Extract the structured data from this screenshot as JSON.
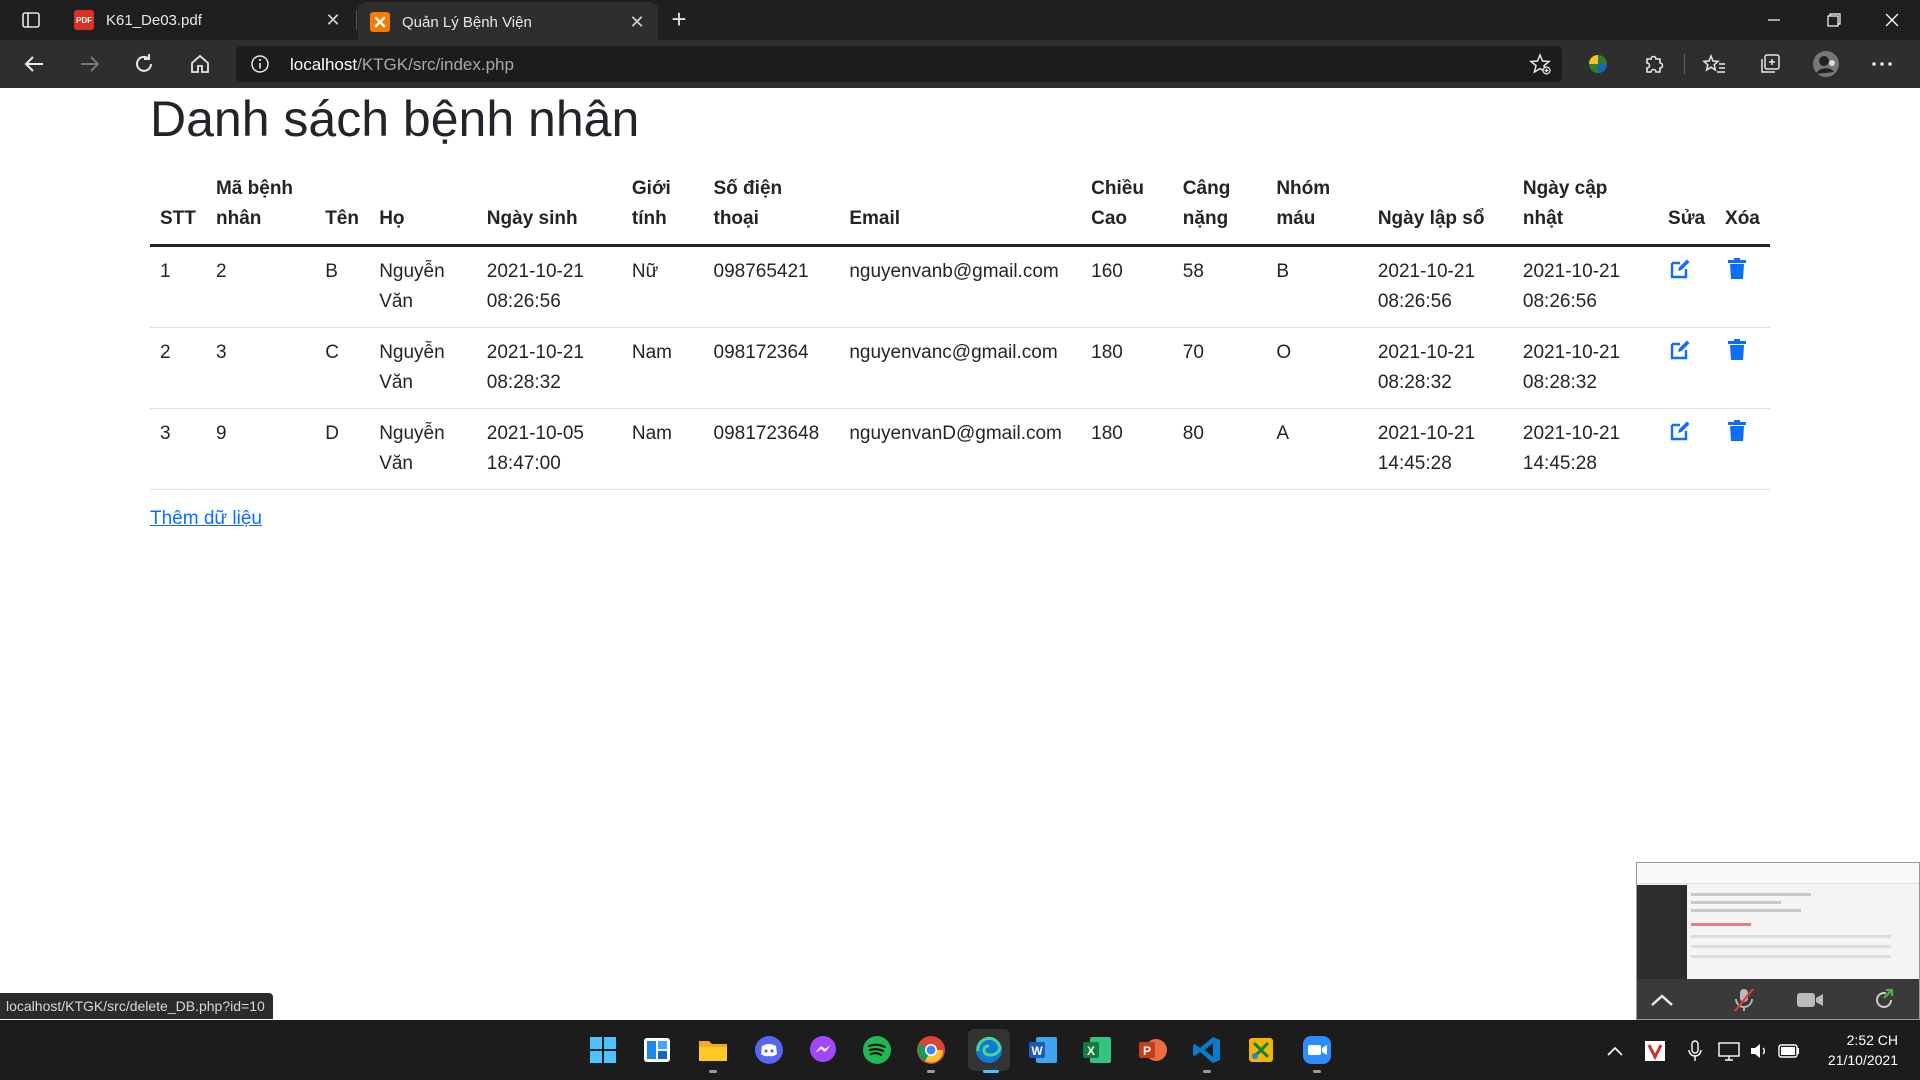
{
  "browser": {
    "tabs": [
      {
        "title": "K61_De03.pdf",
        "favicon": "pdf-icon",
        "active": false
      },
      {
        "title": "Quản Lý Bệnh Viện",
        "favicon": "xampp-icon",
        "active": true
      }
    ],
    "url_host": "localhost",
    "url_path": "/KTGK/src/index.php",
    "status_url": "localhost/KTGK/src/delete_DB.php?id=10"
  },
  "page": {
    "title": "Danh sách bệnh nhân",
    "add_link": "Thêm dữ liệu",
    "columns": [
      "STT",
      "Mã bệnh nhân",
      "Tên",
      "Họ",
      "Ngày sinh",
      "Giới tính",
      "Số điện thoại",
      "Email",
      "Chiều Cao",
      "Câng nặng",
      "Nhóm máu",
      "Ngày lập sổ",
      "Ngày cập nhật",
      "Sửa",
      "Xóa"
    ],
    "rows": [
      {
        "stt": "1",
        "ma": "2",
        "ten": "B",
        "ho": "Nguyễn Văn",
        "ngay_sinh": "2021-10-21 08:26:56",
        "gioi_tinh": "Nữ",
        "sdt": "098765421",
        "email": "nguyenvanb@gmail.com",
        "chieu_cao": "160",
        "can_nang": "58",
        "nhom_mau": "B",
        "ngay_lap": "2021-10-21 08:26:56",
        "ngay_cap_nhat": "2021-10-21 08:26:56"
      },
      {
        "stt": "2",
        "ma": "3",
        "ten": "C",
        "ho": "Nguyễn Văn",
        "ngay_sinh": "2021-10-21 08:28:32",
        "gioi_tinh": "Nam",
        "sdt": "098172364",
        "email": "nguyenvanc@gmail.com",
        "chieu_cao": "180",
        "can_nang": "70",
        "nhom_mau": "O",
        "ngay_lap": "2021-10-21 08:28:32",
        "ngay_cap_nhat": "2021-10-21 08:28:32"
      },
      {
        "stt": "3",
        "ma": "9",
        "ten": "D",
        "ho": "Nguyễn Văn",
        "ngay_sinh": "2021-10-05 18:47:00",
        "gioi_tinh": "Nam",
        "sdt": "0981723648",
        "email": "nguyenvanD@gmail.com",
        "chieu_cao": "180",
        "can_nang": "80",
        "nhom_mau": "A",
        "ngay_lap": "2021-10-21 14:45:28",
        "ngay_cap_nhat": "2021-10-21 14:45:28"
      }
    ],
    "action_icons": {
      "edit": "edit-icon",
      "delete": "trash-icon"
    },
    "accent_color": "#0d6efd"
  },
  "taskbar": {
    "apps": [
      "windows-start-icon",
      "widgets-icon",
      "file-explorer-icon",
      "discord-icon",
      "messenger-icon",
      "spotify-icon",
      "chrome-icon",
      "edge-icon",
      "word-icon",
      "excel-icon",
      "powerpoint-icon",
      "vscode-icon",
      "snip-icon",
      "zoom-icon"
    ],
    "time": "2:52 CH",
    "date": "21/10/2021"
  }
}
